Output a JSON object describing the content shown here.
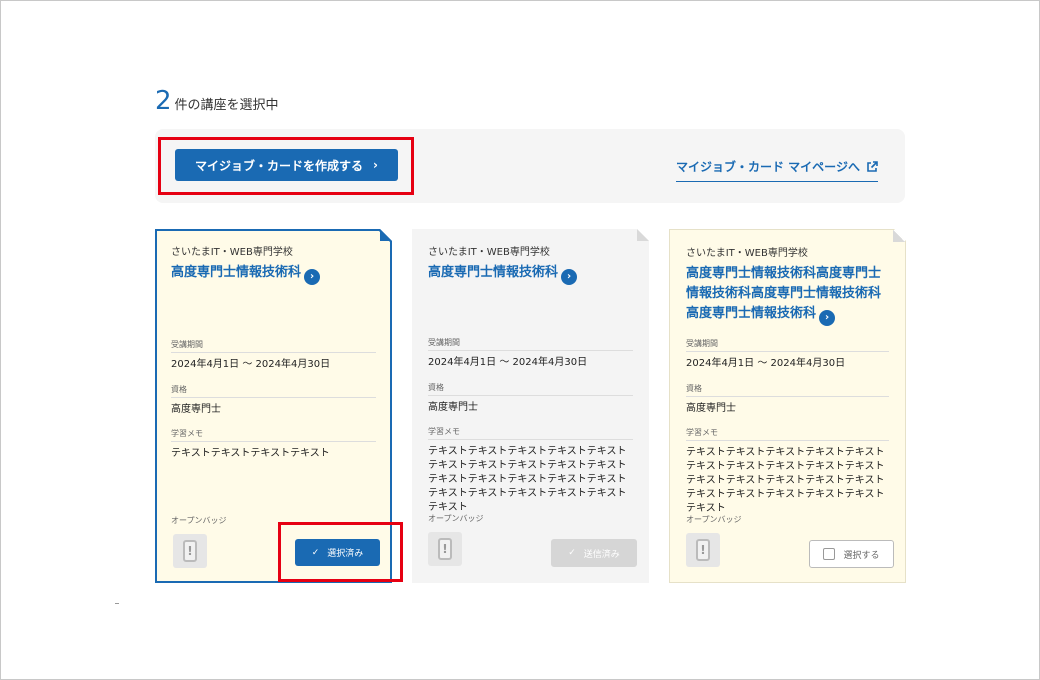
{
  "header": {
    "selected_count": "2",
    "selected_suffix": "件の講座を選択中"
  },
  "actions": {
    "create_button": "マイジョブ・カードを作成する",
    "mypage_link": "マイジョブ・カード マイページへ"
  },
  "labels": {
    "period": "受講期間",
    "qualification": "資格",
    "memo": "学習メモ",
    "badge": "オープンバッジ"
  },
  "cards": [
    {
      "school": "さいたまIT・WEB専門学校",
      "course": "高度専門士情報技術科",
      "period": "2024年4月1日 〜 2024年4月30日",
      "qualification": "高度専門士",
      "memo": "テキストテキストテキストテキスト",
      "button": "選択済み",
      "state": "selected"
    },
    {
      "school": "さいたまIT・WEB専門学校",
      "course": "高度専門士情報技術科",
      "period": "2024年4月1日 〜 2024年4月30日",
      "qualification": "高度専門士",
      "memo": "テキストテキストテキストテキストテキストテキストテキストテキストテキストテキストテキストテキストテキストテキストテキストテキストテキストテキストテキストテキストテキスト",
      "button": "送信済み",
      "state": "sent"
    },
    {
      "school": "さいたまIT・WEB専門学校",
      "course": "高度専門士情報技術科高度専門士情報技術科高度専門士情報技術科高度専門士情報技術科",
      "period": "2024年4月1日 〜 2024年4月30日",
      "qualification": "高度専門士",
      "memo": "テキストテキストテキストテキストテキストテキストテキストテキストテキストテキストテキストテキストテキストテキストテキストテキストテキストテキストテキストテキストテキスト",
      "button": "選択する",
      "state": "unselected"
    }
  ],
  "colors": {
    "accent": "#1a6ab3",
    "highlight": "#e60012",
    "card_bg": "#fffbe8",
    "card_sent_bg": "#f4f4f4"
  }
}
